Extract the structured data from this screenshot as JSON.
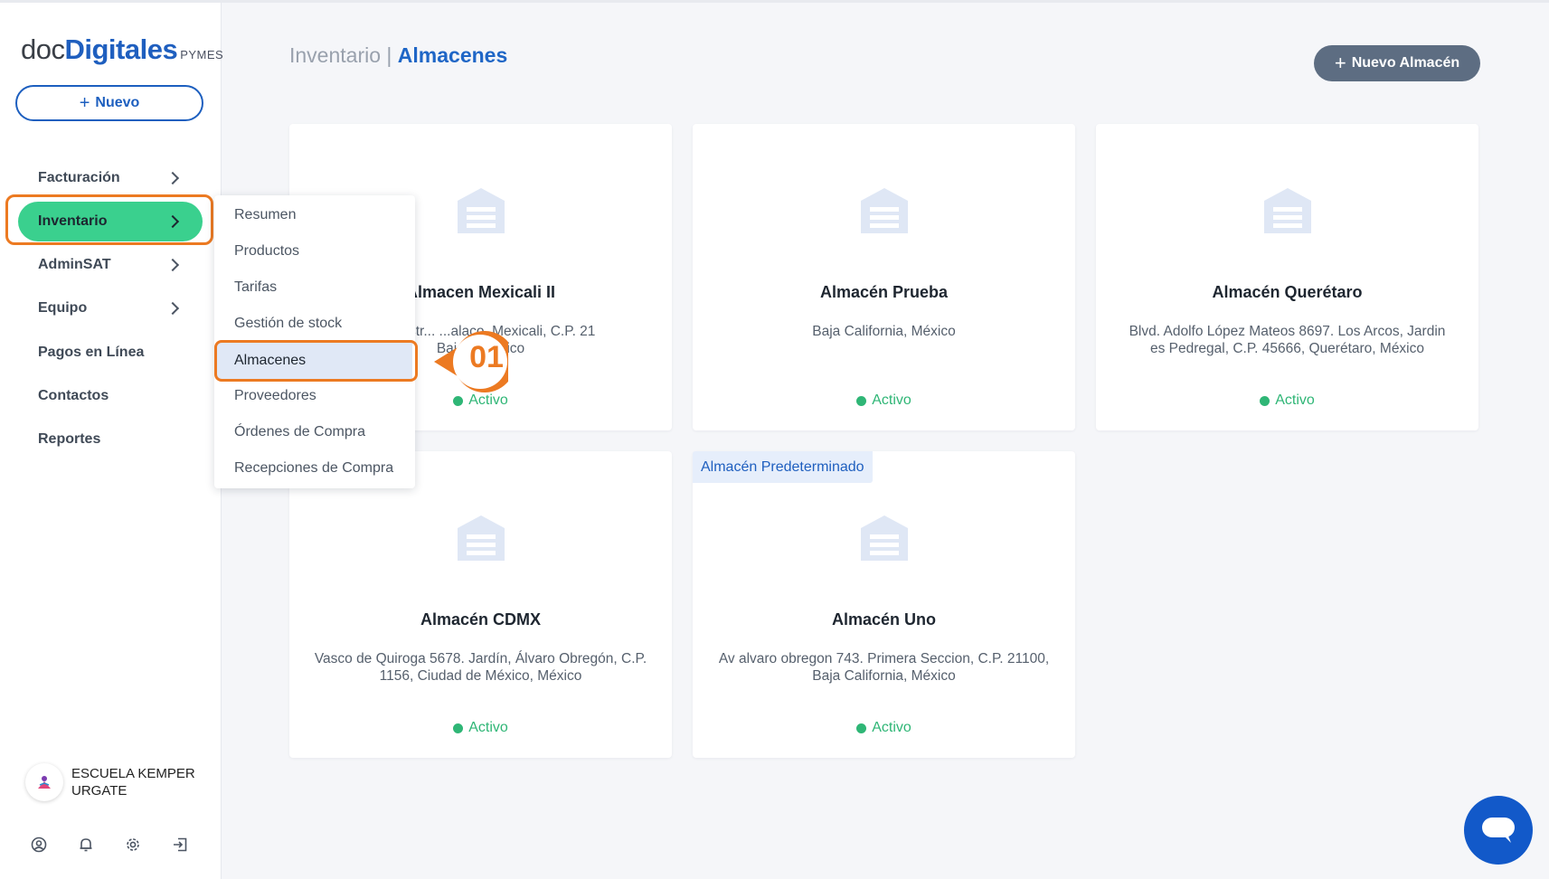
{
  "logo": {
    "doc": "doc",
    "digitales": "Digitales",
    "pymes": "PYMES"
  },
  "sidebar": {
    "new_button": "Nuevo",
    "items": [
      {
        "label": "Facturación",
        "has_chevron": true
      },
      {
        "label": "Inventario",
        "has_chevron": true,
        "active": true
      },
      {
        "label": "AdminSAT",
        "has_chevron": true
      },
      {
        "label": "Equipo",
        "has_chevron": true
      },
      {
        "label": "Pagos en Línea",
        "has_chevron": false
      },
      {
        "label": "Contactos",
        "has_chevron": false
      },
      {
        "label": "Reportes",
        "has_chevron": false
      }
    ],
    "company": {
      "name": "ESCUELA KEMPER URGATE"
    },
    "bottom_icons": [
      "user-circle-icon",
      "bell-icon",
      "gear-icon",
      "logout-icon"
    ]
  },
  "submenu": {
    "items": [
      {
        "label": "Resumen"
      },
      {
        "label": "Productos"
      },
      {
        "label": "Tarifas"
      },
      {
        "label": "Gestión de stock"
      },
      {
        "label": "Almacenes",
        "active": true
      },
      {
        "label": "Proveedores"
      },
      {
        "label": "Órdenes de Compra"
      },
      {
        "label": "Recepciones de Compra"
      }
    ]
  },
  "step_marker": "01",
  "header": {
    "section": "Inventario",
    "separator": "|",
    "page": "Almacenes",
    "new_button": "Nuevo Almacén"
  },
  "cards": [
    {
      "title": "Almacen Mexicali II",
      "address": "...0. Industrial ...laco, Mexicali, C.P. 21 ... Baja ... México",
      "address_line1": "0. Industr... ...alaco, Mexicali, C.P. 21",
      "address_line2": "Baja...   México",
      "status": "Activo"
    },
    {
      "title": "Almacén Prueba",
      "address_line1": "Baja California, México",
      "address_line2": "",
      "status": "Activo"
    },
    {
      "title": "Almacén Querétaro",
      "address_line1": "Blvd. Adolfo López Mateos 8697. Los Arcos, Jardin",
      "address_line2": "es Pedregal, C.P. 45666, Querétaro, México",
      "status": "Activo"
    },
    {
      "title": "Almacén CDMX",
      "address_line1": "Vasco de Quiroga 5678. Jardín, Álvaro Obregón, C.P.",
      "address_line2": "1156, Ciudad de México, México",
      "status": "Activo"
    },
    {
      "title": "Almacén Uno",
      "badge": "Almacén Predeterminado",
      "address_line1": "Av alvaro obregon 743. Primera Seccion, C.P. 21100,",
      "address_line2": "Baja California, México",
      "status": "Activo"
    }
  ],
  "colors": {
    "accent_green": "#3ad08e",
    "brand_blue": "#1f5fbf",
    "highlight_orange": "#ec7a22",
    "status_green": "#2fb676"
  }
}
